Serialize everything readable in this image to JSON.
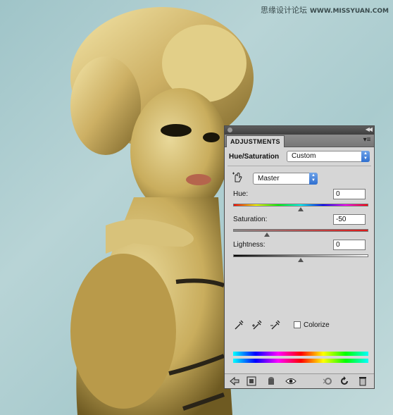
{
  "watermark": {
    "text": "思缘设计论坛",
    "site": "WWW.MISSYUAN.COM"
  },
  "panel": {
    "tab_title": "ADJUSTMENTS",
    "adjustment_name": "Hue/Saturation",
    "preset": {
      "label": "Custom"
    },
    "channel": {
      "label": "Master"
    },
    "sliders": {
      "hue": {
        "label": "Hue:",
        "value": "0",
        "position": 0.5
      },
      "saturation": {
        "label": "Saturation:",
        "value": "-50",
        "position": 0.25
      },
      "lightness": {
        "label": "Lightness:",
        "value": "0",
        "position": 0.5
      }
    },
    "colorize": {
      "label": "Colorize",
      "checked": false
    },
    "icons": {
      "hand": "targeted-adjustment-icon",
      "dropper1": "eyedropper-icon",
      "dropper2": "eyedropper-plus-icon",
      "dropper3": "eyedropper-minus-icon",
      "back": "back-arrow-icon",
      "clip": "clip-to-layer-icon",
      "visibility": "eye-icon",
      "reset": "reset-icon",
      "delete": "trash-icon"
    }
  }
}
